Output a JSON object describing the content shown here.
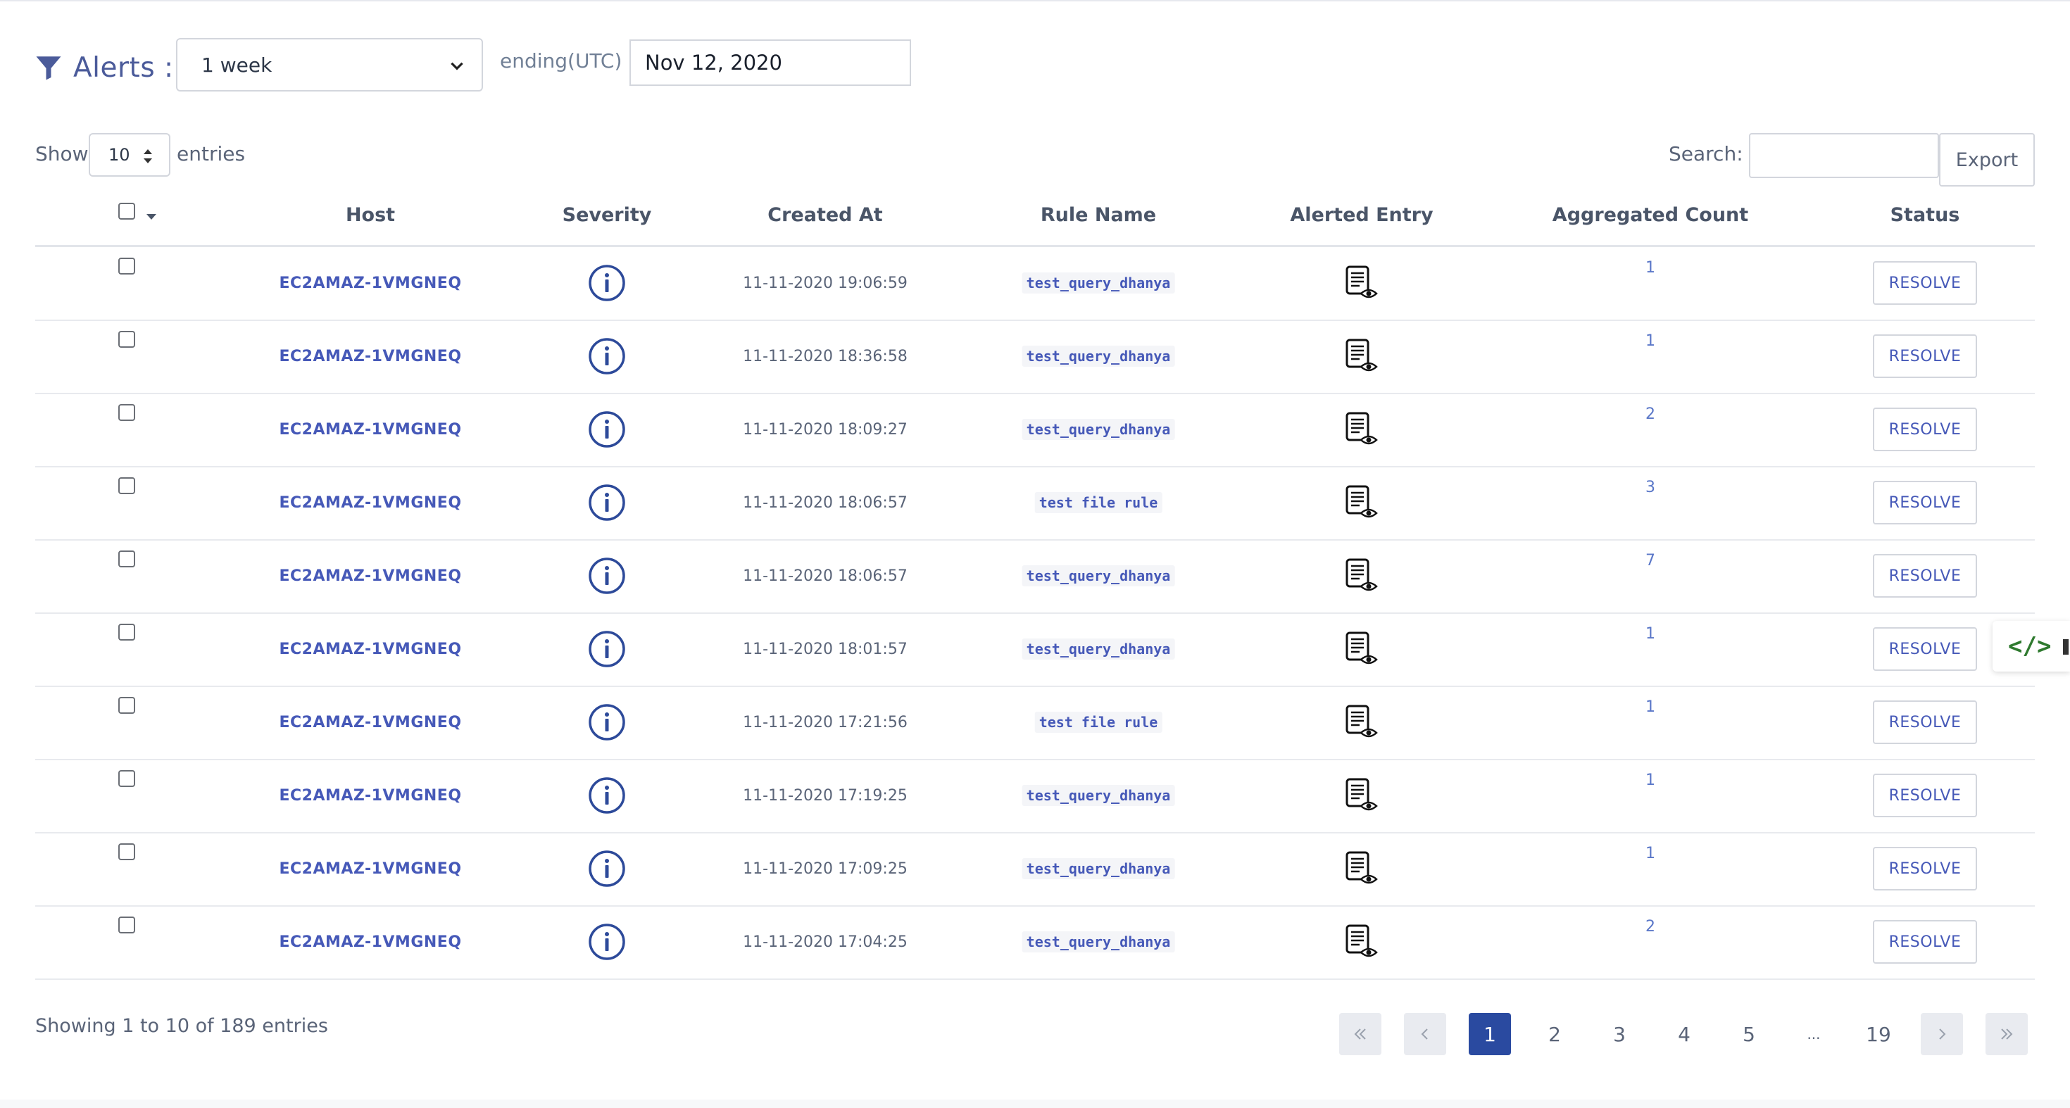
{
  "filter": {
    "title": "Alerts :",
    "range": "1 week",
    "ending_label": "ending(UTC)",
    "date": "Nov 12, 2020"
  },
  "controls": {
    "show_label": "Show",
    "entries_value": "10",
    "entries_label": "entries",
    "search_label": "Search:",
    "search_value": "",
    "export_label": "Export"
  },
  "table": {
    "headers": {
      "host": "Host",
      "severity": "Severity",
      "created_at": "Created At",
      "rule_name": "Rule Name",
      "alerted_entry": "Alerted Entry",
      "aggregated_count": "Aggregated Count",
      "status": "Status"
    },
    "rows": [
      {
        "host": "EC2AMAZ-1VMGNEQ",
        "severity": "info-icon",
        "created_at": "11-11-2020 19:06:59",
        "rule": "test_query_dhanya",
        "count": "1",
        "status": "RESOLVE"
      },
      {
        "host": "EC2AMAZ-1VMGNEQ",
        "severity": "info-icon",
        "created_at": "11-11-2020 18:36:58",
        "rule": "test_query_dhanya",
        "count": "1",
        "status": "RESOLVE"
      },
      {
        "host": "EC2AMAZ-1VMGNEQ",
        "severity": "info-icon",
        "created_at": "11-11-2020 18:09:27",
        "rule": "test_query_dhanya",
        "count": "2",
        "status": "RESOLVE"
      },
      {
        "host": "EC2AMAZ-1VMGNEQ",
        "severity": "info-icon",
        "created_at": "11-11-2020 18:06:57",
        "rule": "test file rule",
        "count": "3",
        "status": "RESOLVE"
      },
      {
        "host": "EC2AMAZ-1VMGNEQ",
        "severity": "info-icon",
        "created_at": "11-11-2020 18:06:57",
        "rule": "test_query_dhanya",
        "count": "7",
        "status": "RESOLVE"
      },
      {
        "host": "EC2AMAZ-1VMGNEQ",
        "severity": "info-icon",
        "created_at": "11-11-2020 18:01:57",
        "rule": "test_query_dhanya",
        "count": "1",
        "status": "RESOLVE"
      },
      {
        "host": "EC2AMAZ-1VMGNEQ",
        "severity": "info-icon",
        "created_at": "11-11-2020 17:21:56",
        "rule": "test file rule",
        "count": "1",
        "status": "RESOLVE"
      },
      {
        "host": "EC2AMAZ-1VMGNEQ",
        "severity": "info-icon",
        "created_at": "11-11-2020 17:19:25",
        "rule": "test_query_dhanya",
        "count": "1",
        "status": "RESOLVE"
      },
      {
        "host": "EC2AMAZ-1VMGNEQ",
        "severity": "info-icon",
        "created_at": "11-11-2020 17:09:25",
        "rule": "test_query_dhanya",
        "count": "1",
        "status": "RESOLVE"
      },
      {
        "host": "EC2AMAZ-1VMGNEQ",
        "severity": "info-icon",
        "created_at": "11-11-2020 17:04:25",
        "rule": "test_query_dhanya",
        "count": "2",
        "status": "RESOLVE"
      }
    ]
  },
  "footer": {
    "showing": "Showing 1 to 10 of 189 entries",
    "pages": [
      "1",
      "2",
      "3",
      "4",
      "5",
      "...",
      "19"
    ],
    "current_page": "1"
  },
  "colors": {
    "accent": "#4659b8",
    "active_page": "#2a4aa0",
    "severity_icon": "#2d4a9a",
    "widget_code": "#2f7a2f"
  },
  "side_widget": {
    "icon": "code-icon",
    "label": "</>"
  }
}
